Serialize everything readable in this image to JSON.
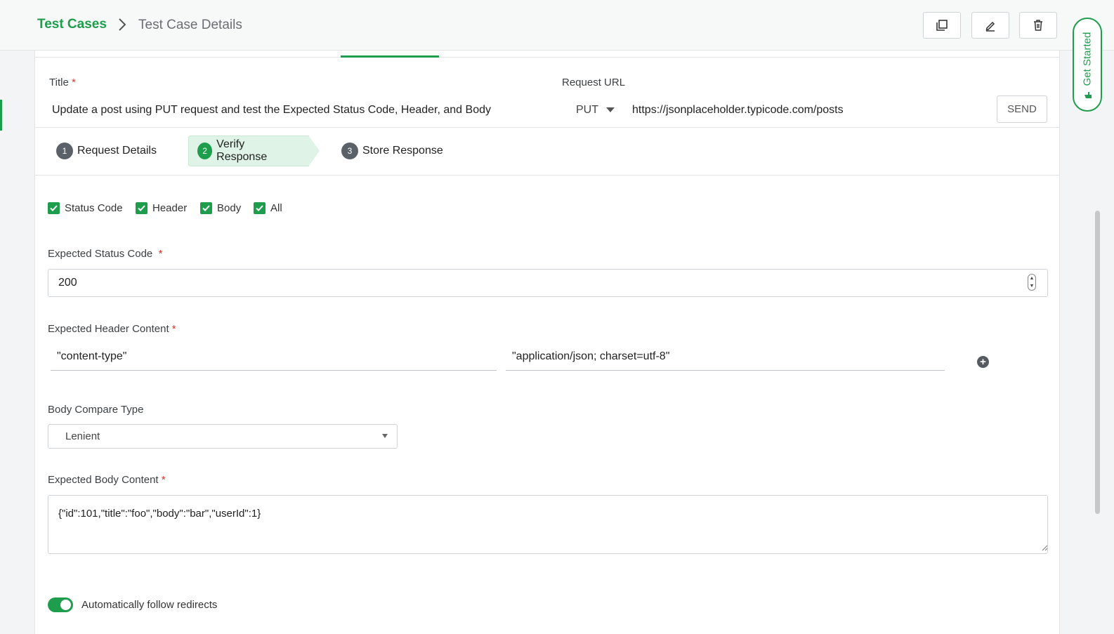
{
  "breadcrumb": {
    "root": "Test Cases",
    "current": "Test Case Details"
  },
  "toolbar": {
    "icons": [
      "copy-icon",
      "edit-icon",
      "trash-icon"
    ]
  },
  "form": {
    "title_label": "Title",
    "title_value": "Update a post using PUT request and test the Expected Status Code, Header, and Body",
    "request_url_label": "Request URL",
    "method": "PUT",
    "url": "https://jsonplaceholder.typicode.com/posts",
    "send_label": "SEND"
  },
  "steps": [
    {
      "num": "1",
      "label": "Request Details"
    },
    {
      "num": "2",
      "label": "Verify Response",
      "active": true
    },
    {
      "num": "3",
      "label": "Store Response"
    }
  ],
  "verify": {
    "checks": [
      {
        "label": "Status Code",
        "checked": true
      },
      {
        "label": "Header",
        "checked": true
      },
      {
        "label": "Body",
        "checked": true
      },
      {
        "label": "All",
        "checked": true
      }
    ],
    "status_code_label": "Expected Status Code",
    "status_code_value": "200",
    "header_label": "Expected Header Content",
    "header_key": "\"content-type\"",
    "header_value": "\"application/json; charset=utf-8\"",
    "body_compare_label": "Body Compare Type",
    "body_compare_value": "Lenient",
    "body_label": "Expected Body Content",
    "body_value": "{\"id\":101,\"title\":\"foo\",\"body\":\"bar\",\"userId\":1}",
    "redirect_label": "Automatically follow redirects",
    "redirect_on": true
  },
  "side": {
    "get_started": "Get Started"
  },
  "colors": {
    "accent": "#1e9e4d",
    "required": "#d9342b"
  }
}
